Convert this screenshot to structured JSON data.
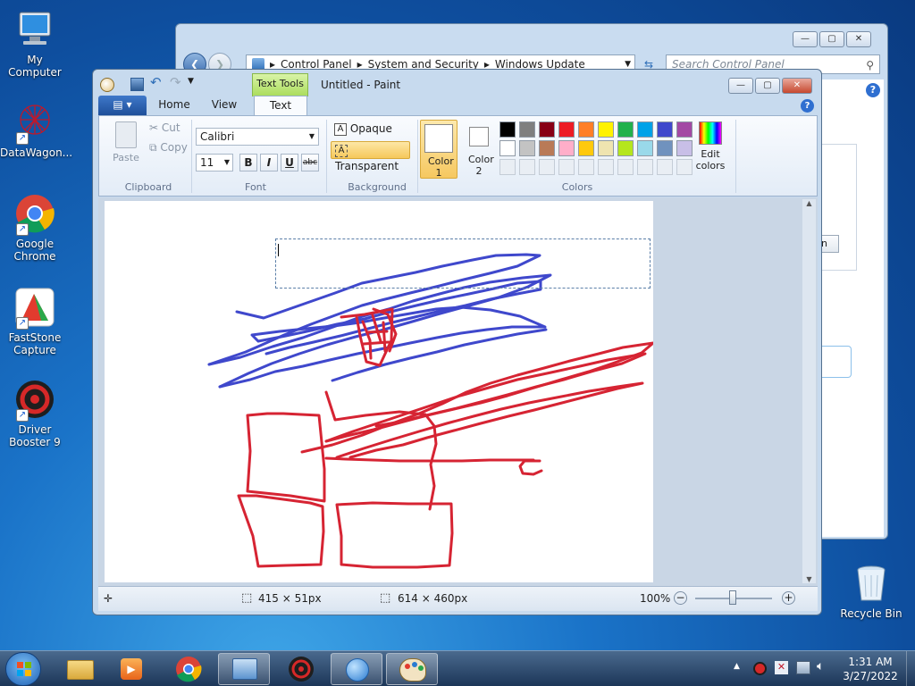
{
  "desktop": {
    "icons": [
      {
        "label": "My Computer"
      },
      {
        "label": "DataWagon..."
      },
      {
        "label": "Google Chrome"
      },
      {
        "label": "FastStone Capture"
      },
      {
        "label": "Driver Booster 9"
      },
      {
        "label": "Recycle Bin"
      }
    ]
  },
  "control_panel": {
    "breadcrumb": [
      "Control Panel",
      "System and Security",
      "Windows Update"
    ],
    "search_placeholder": "Search Control Panel"
  },
  "paint": {
    "title": "Untitled - Paint",
    "contextual_tab": "Text Tools",
    "tabs": {
      "home": "Home",
      "view": "View",
      "text": "Text"
    },
    "clipboard": {
      "paste": "Paste",
      "cut": "Cut",
      "copy": "Copy",
      "label": "Clipboard"
    },
    "font": {
      "family": "Calibri",
      "size": "11",
      "bold": "B",
      "italic": "I",
      "underline": "U",
      "strike": "abc",
      "label": "Font"
    },
    "background": {
      "opaque": "Opaque",
      "transparent": "Transparent",
      "label": "Background"
    },
    "colors": {
      "color1": "Color 1",
      "color2": "Color 2",
      "edit": "Edit colors",
      "label": "Colors",
      "color1_value": "#ffffff",
      "color2_value": "#ffffff",
      "row1": [
        "#000000",
        "#7f7f7f",
        "#880015",
        "#ed1c24",
        "#ff7f27",
        "#fff200",
        "#22b14c",
        "#00a2e8",
        "#3f48cc",
        "#a349a4"
      ],
      "row2": [
        "#ffffff",
        "#c3c3c3",
        "#b97a57",
        "#ffaec9",
        "#ffc90e",
        "#efe4b0",
        "#b5e61d",
        "#99d9ea",
        "#7092be",
        "#c8bfe7"
      ]
    },
    "status": {
      "selection_size": "415 × 51px",
      "image_size": "614 × 460px",
      "zoom": "100%"
    }
  },
  "taskbar": {
    "time": "1:31 AM",
    "date": "3/27/2022"
  }
}
